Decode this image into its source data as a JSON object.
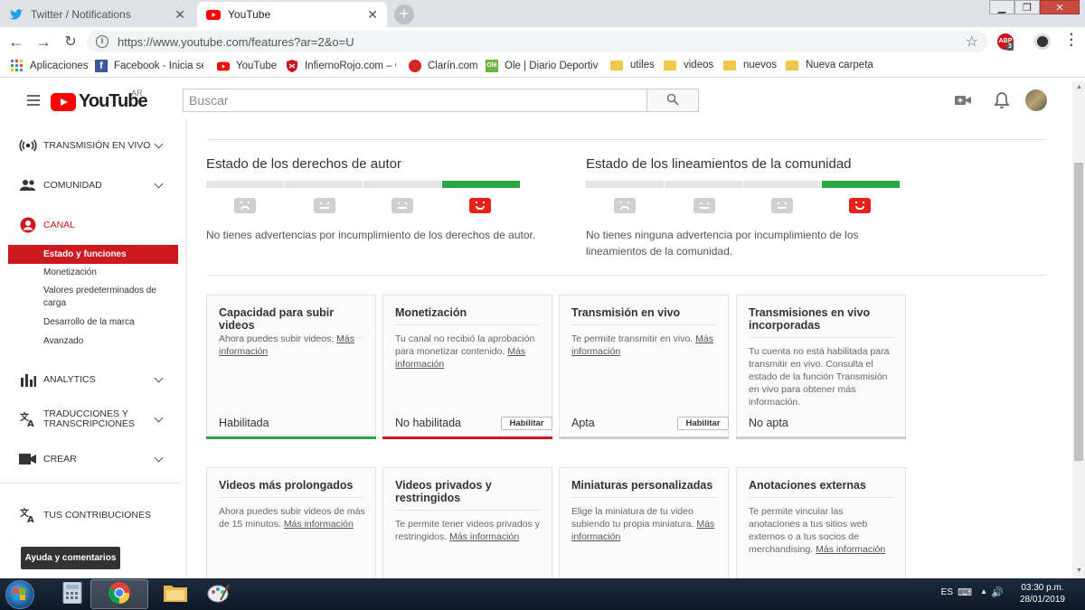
{
  "browser": {
    "tabs": [
      {
        "label": "Twitter / Notifications"
      },
      {
        "label": "YouTube"
      }
    ],
    "url": "https://www.youtube.com/features?ar=2&o=U",
    "ext_badge": "3",
    "bookmarks": [
      {
        "label": "Aplicaciones"
      },
      {
        "label": "Facebook - Inicia ses"
      },
      {
        "label": "YouTube"
      },
      {
        "label": "InfiernoRojo.com – C"
      },
      {
        "label": "Clarín.com"
      },
      {
        "label": "Ole | Diario Deportivo"
      },
      {
        "label": "utiles"
      },
      {
        "label": "videos"
      },
      {
        "label": "nuevos"
      },
      {
        "label": "Nueva carpeta"
      }
    ]
  },
  "masthead": {
    "logo_text": "YouTube",
    "region": "AR",
    "search_placeholder": "Buscar"
  },
  "sidebar": {
    "live": "TRANSMISIÓN EN VIVO",
    "community": "COMUNIDAD",
    "channel": "CANAL",
    "channel_items": [
      {
        "label": "Estado y funciones"
      },
      {
        "label": "Monetización"
      },
      {
        "label": "Valores predeterminados de carga"
      },
      {
        "label": "Desarrollo de la marca"
      },
      {
        "label": "Avanzado"
      }
    ],
    "analytics": "ANALYTICS",
    "translations": "TRADUCCIONES Y TRANSCRIPCIONES",
    "create": "CREAR",
    "contributions": "TUS CONTRIBUCIONES",
    "help": "Ayuda y comentarios"
  },
  "status": {
    "copyright_title": "Estado de los derechos de autor",
    "copyright_note": "No tienes advertencias por incumplimiento de los derechos de autor.",
    "community_title": "Estado de los lineamientos de la comunidad",
    "community_note": "No tienes ninguna advertencia por incumplimiento de los lineamientos de la comunidad."
  },
  "cards": [
    {
      "title": "Capacidad para subir videos",
      "desc": "Ahora puedes subir videos.",
      "link": "Más información",
      "status": "Habilitada",
      "button": ""
    },
    {
      "title": "Monetización",
      "desc": "Tu canal no recibió la aprobación para monetizar contenido.",
      "link": "Más información",
      "status": "No habilitada",
      "button": "Habilitar"
    },
    {
      "title": "Transmisión en vivo",
      "desc": "Te permite transmitir en vivo.",
      "link": "Más información",
      "status": "Apta",
      "button": "Habilitar"
    },
    {
      "title": "Transmisiones en vivo incorporadas",
      "desc": "Tu cuenta no está habilitada para transmitir en vivo. Consulta el estado de la función Transmisión en vivo para obtener más información.",
      "link": "",
      "status": "No apta",
      "button": ""
    },
    {
      "title": "Videos más prolongados",
      "desc": "Ahora puedes subir videos de más de 15 minutos.",
      "link": "Más información",
      "status": "",
      "button": ""
    },
    {
      "title": "Videos privados y restringidos",
      "desc": "Te permite tener videos privados y restringidos.",
      "link": "Más información",
      "status": "",
      "button": ""
    },
    {
      "title": "Miniaturas personalizadas",
      "desc": "Elige la miniatura de tu video subiendo tu propia miniatura.",
      "link": "Más información",
      "status": "",
      "button": ""
    },
    {
      "title": "Anotaciones externas",
      "desc": "Te permite vincular las anotaciones a tus sitios web externos o a tus socios de merchandising.",
      "link": "Más información",
      "status": "",
      "button": ""
    }
  ],
  "taskbar": {
    "lang": "ES",
    "time": "03:30 p.m.",
    "date": "28/01/2019"
  },
  "colors": {
    "youtube_red": "#ff0000",
    "active_red": "#cc181e",
    "ok_green": "#2ba640"
  }
}
